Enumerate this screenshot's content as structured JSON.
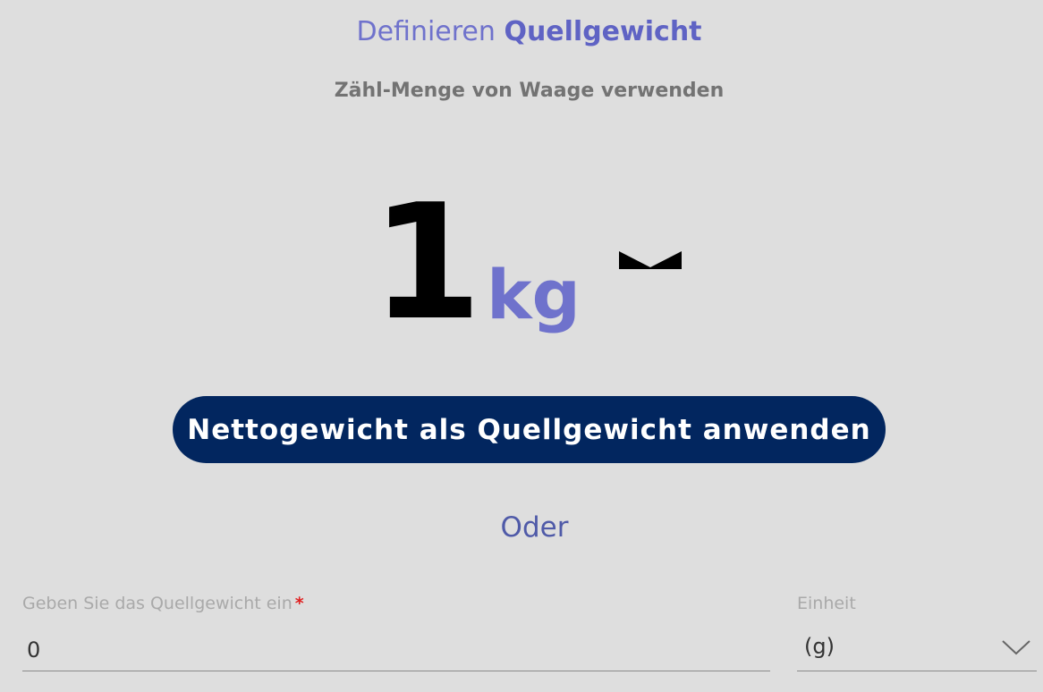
{
  "header": {
    "title_prefix": "Definieren",
    "title_bold": "Quellgewicht",
    "subtitle": "Zähl-Menge von Waage verwenden"
  },
  "scale": {
    "value": "1",
    "unit": "kg",
    "unit_toggle_icon": "chevron-down-icon"
  },
  "apply_button": {
    "label": "Nettogewicht als Quellgewicht anwenden",
    "color": "#02265f"
  },
  "divider_text": "Oder",
  "form": {
    "weight_label": "Geben Sie das Quellgewicht ein",
    "required_marker": "*",
    "weight_value": "0",
    "unit_label": "Einheit",
    "unit_value": "(g)",
    "unit_dropdown_icon": "chevron-down-icon"
  },
  "colors": {
    "background": "#dedede",
    "accent": "#6f72cc",
    "required": "#e02020"
  }
}
